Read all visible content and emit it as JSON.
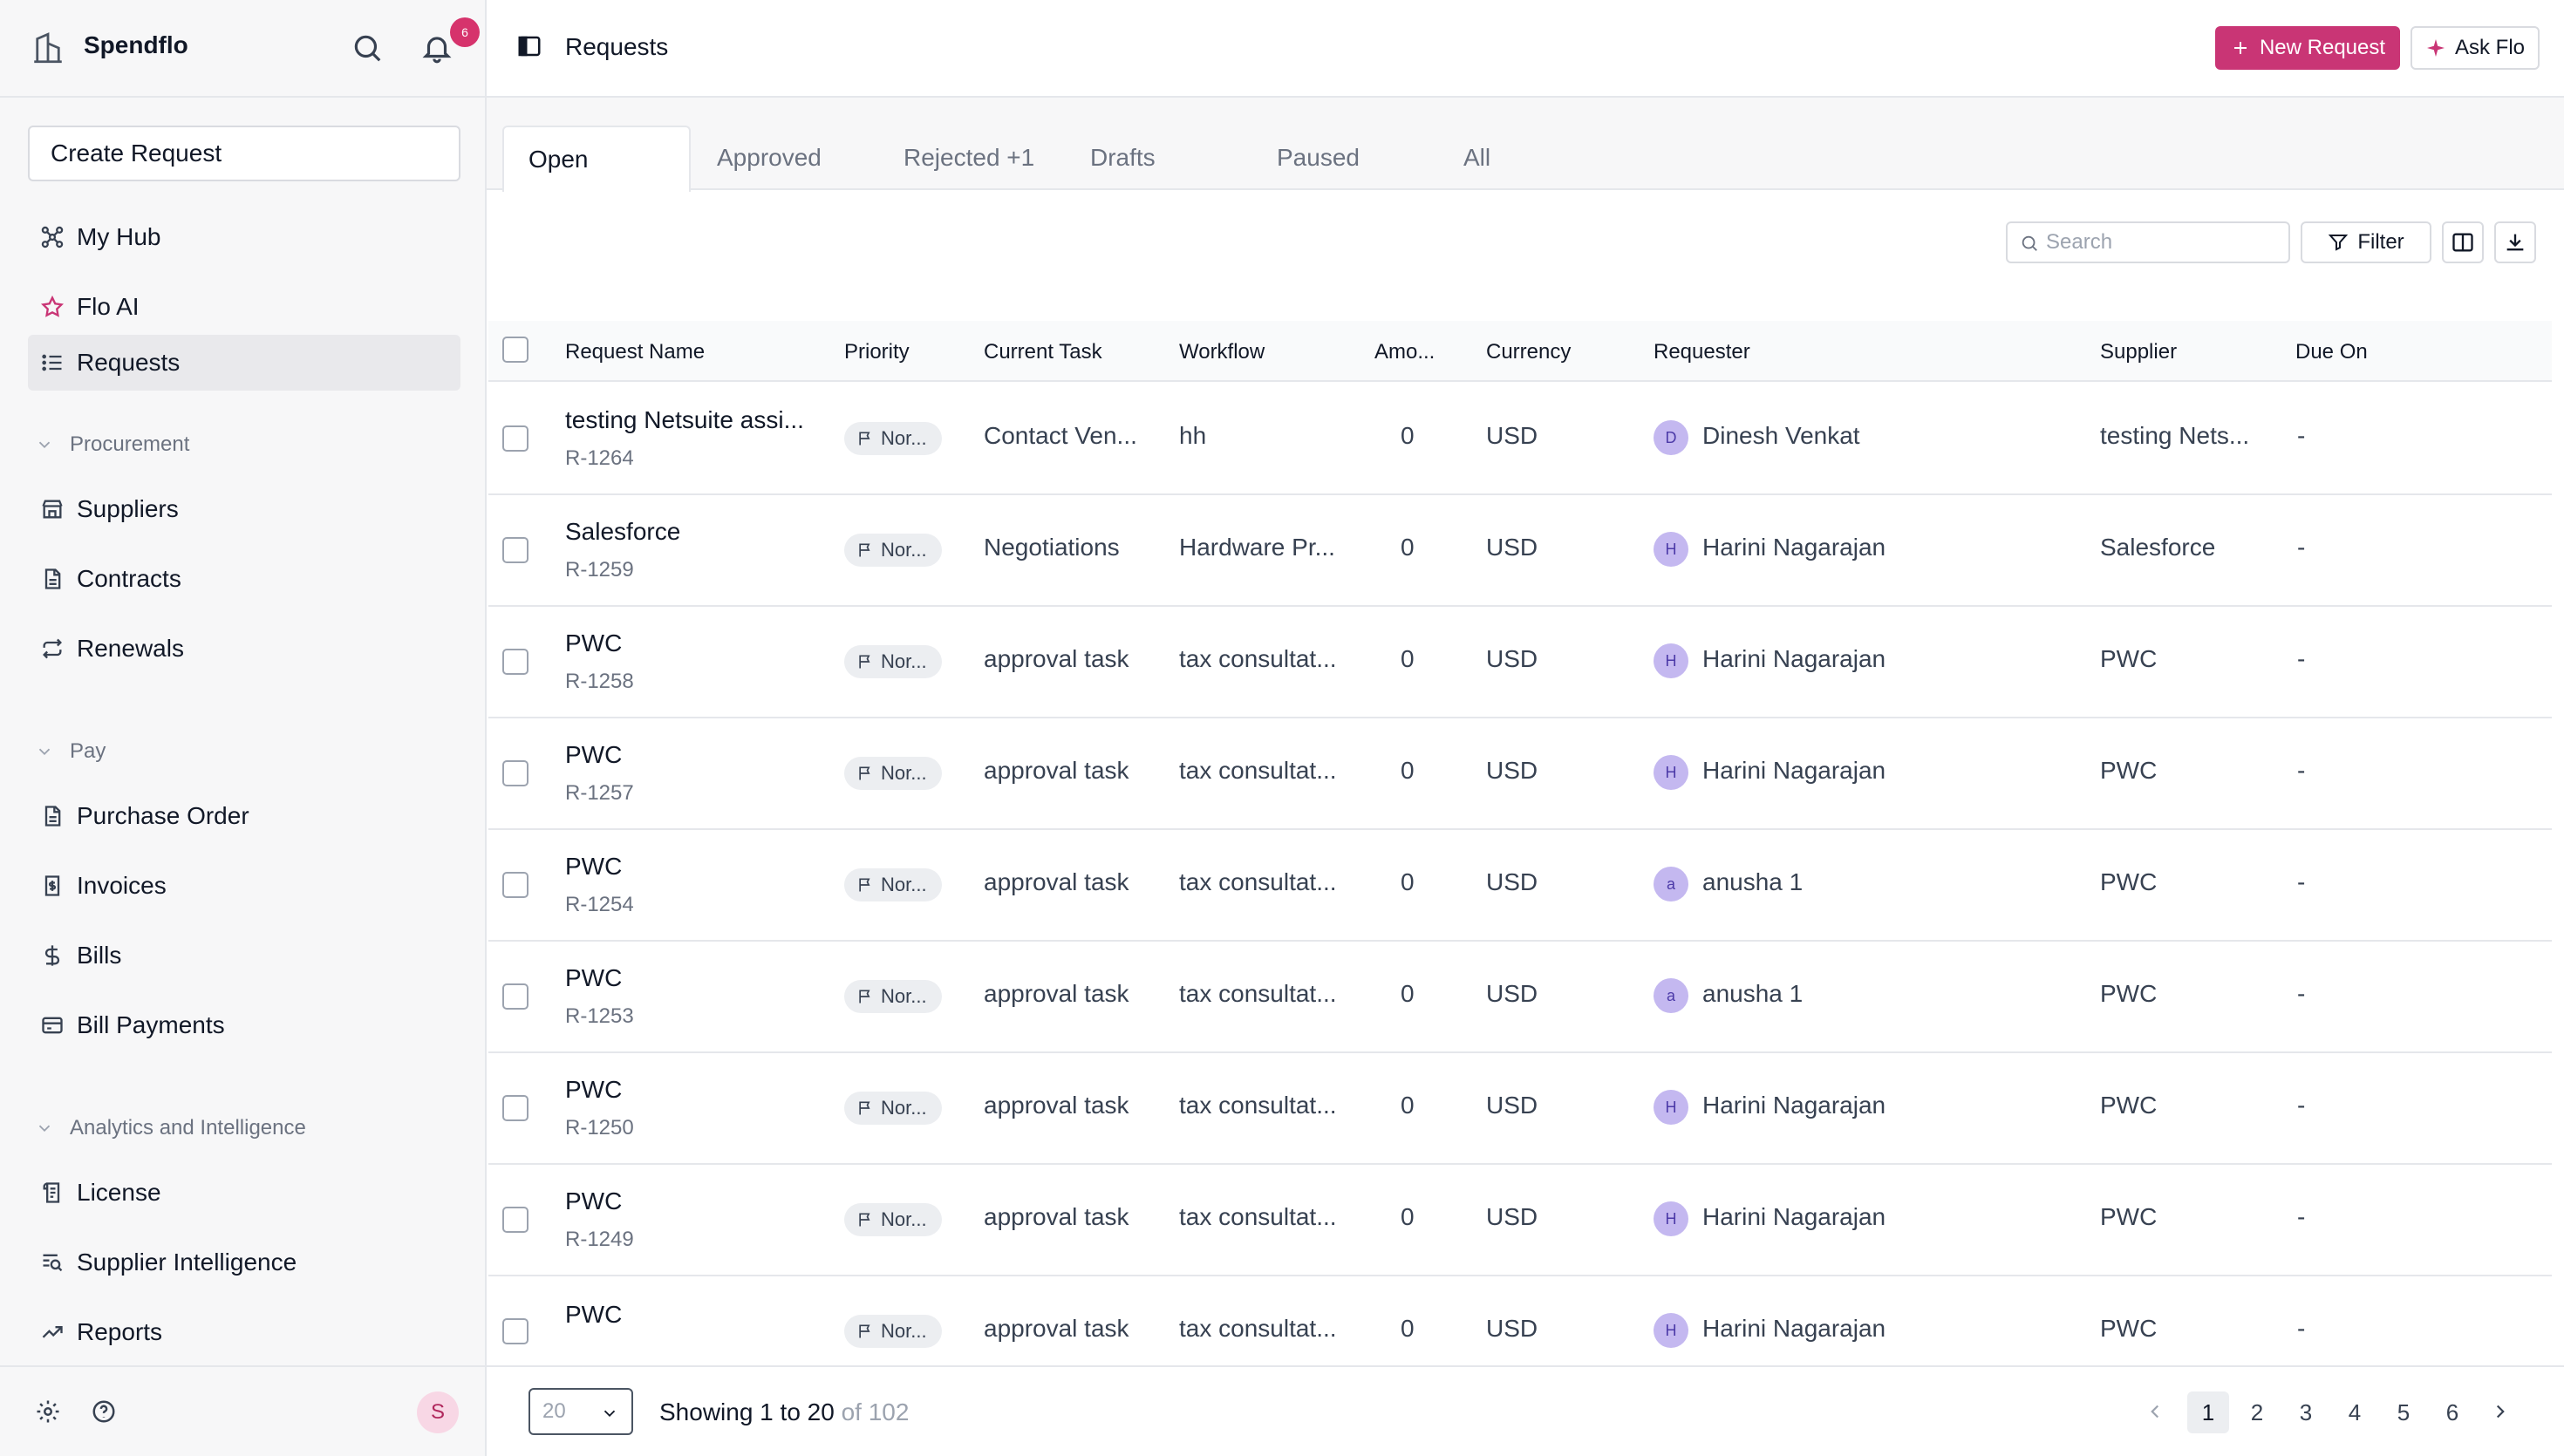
{
  "app": {
    "name": "Spendflo",
    "notification_count": "6",
    "user_initial": "S"
  },
  "sidebar": {
    "create_label": "Create Request",
    "top_items": [
      {
        "label": "My Hub",
        "icon": "hub-icon"
      },
      {
        "label": "Flo AI",
        "icon": "star-icon"
      },
      {
        "label": "Requests",
        "icon": "list-icon",
        "active": true
      }
    ],
    "sections": [
      {
        "label": "Procurement",
        "items": [
          {
            "label": "Suppliers",
            "icon": "store-icon"
          },
          {
            "label": "Contracts",
            "icon": "document-icon"
          },
          {
            "label": "Renewals",
            "icon": "repeat-icon"
          }
        ]
      },
      {
        "label": "Pay",
        "items": [
          {
            "label": "Purchase Order",
            "icon": "document-icon"
          },
          {
            "label": "Invoices",
            "icon": "invoice-icon"
          },
          {
            "label": "Bills",
            "icon": "dollar-icon"
          },
          {
            "label": "Bill Payments",
            "icon": "card-icon"
          }
        ]
      },
      {
        "label": "Analytics and Intelligence",
        "items": [
          {
            "label": "License",
            "icon": "license-icon"
          },
          {
            "label": "Supplier Intelligence",
            "icon": "search-list-icon"
          },
          {
            "label": "Reports",
            "icon": "trend-icon"
          }
        ]
      }
    ]
  },
  "header": {
    "title": "Requests",
    "new_request_label": "New Request",
    "ask_flo_label": "Ask Flo"
  },
  "tabs": [
    {
      "label": "Open",
      "active": true
    },
    {
      "label": "Approved"
    },
    {
      "label": "Rejected +1"
    },
    {
      "label": "Drafts"
    },
    {
      "label": "Paused"
    },
    {
      "label": "All"
    }
  ],
  "toolbar": {
    "search_placeholder": "Search",
    "filter_label": "Filter"
  },
  "table": {
    "columns": [
      "Request Name",
      "Priority",
      "Current Task",
      "Workflow",
      "Amo...",
      "Currency",
      "Requester",
      "Supplier",
      "Due On"
    ],
    "rows": [
      {
        "name": "testing Netsuite assi...",
        "id": "R-1264",
        "priority": "Nor...",
        "task": "Contact Ven...",
        "workflow": "hh",
        "amount": "0",
        "currency": "USD",
        "requester_initial": "D",
        "requester": "Dinesh Venkat",
        "supplier": "testing Nets...",
        "due": "-"
      },
      {
        "name": "Salesforce",
        "id": "R-1259",
        "priority": "Nor...",
        "task": "Negotiations",
        "workflow": "Hardware Pr...",
        "amount": "0",
        "currency": "USD",
        "requester_initial": "H",
        "requester": "Harini Nagarajan",
        "supplier": "Salesforce",
        "due": "-"
      },
      {
        "name": "PWC",
        "id": "R-1258",
        "priority": "Nor...",
        "task": "approval task",
        "workflow": "tax consultat...",
        "amount": "0",
        "currency": "USD",
        "requester_initial": "H",
        "requester": "Harini Nagarajan",
        "supplier": "PWC",
        "due": "-"
      },
      {
        "name": "PWC",
        "id": "R-1257",
        "priority": "Nor...",
        "task": "approval task",
        "workflow": "tax consultat...",
        "amount": "0",
        "currency": "USD",
        "requester_initial": "H",
        "requester": "Harini Nagarajan",
        "supplier": "PWC",
        "due": "-"
      },
      {
        "name": "PWC",
        "id": "R-1254",
        "priority": "Nor...",
        "task": "approval task",
        "workflow": "tax consultat...",
        "amount": "0",
        "currency": "USD",
        "requester_initial": "a",
        "requester": "anusha 1",
        "supplier": "PWC",
        "due": "-"
      },
      {
        "name": "PWC",
        "id": "R-1253",
        "priority": "Nor...",
        "task": "approval task",
        "workflow": "tax consultat...",
        "amount": "0",
        "currency": "USD",
        "requester_initial": "a",
        "requester": "anusha 1",
        "supplier": "PWC",
        "due": "-"
      },
      {
        "name": "PWC",
        "id": "R-1250",
        "priority": "Nor...",
        "task": "approval task",
        "workflow": "tax consultat...",
        "amount": "0",
        "currency": "USD",
        "requester_initial": "H",
        "requester": "Harini Nagarajan",
        "supplier": "PWC",
        "due": "-"
      },
      {
        "name": "PWC",
        "id": "R-1249",
        "priority": "Nor...",
        "task": "approval task",
        "workflow": "tax consultat...",
        "amount": "0",
        "currency": "USD",
        "requester_initial": "H",
        "requester": "Harini Nagarajan",
        "supplier": "PWC",
        "due": "-"
      },
      {
        "name": "PWC",
        "id": "",
        "priority": "Nor...",
        "task": "approval task",
        "workflow": "tax consultat...",
        "amount": "0",
        "currency": "USD",
        "requester_initial": "H",
        "requester": "Harini Nagarajan",
        "supplier": "PWC",
        "due": "-"
      }
    ]
  },
  "pagination": {
    "page_size": "20",
    "showing_text": "Showing 1 to 20",
    "total_text": "of 102",
    "pages": [
      "1",
      "2",
      "3",
      "4",
      "5",
      "6"
    ],
    "current_page": "1"
  },
  "colors": {
    "accent": "#c93575",
    "badge": "#d6336c",
    "active_nav": "#e9e9ec"
  }
}
